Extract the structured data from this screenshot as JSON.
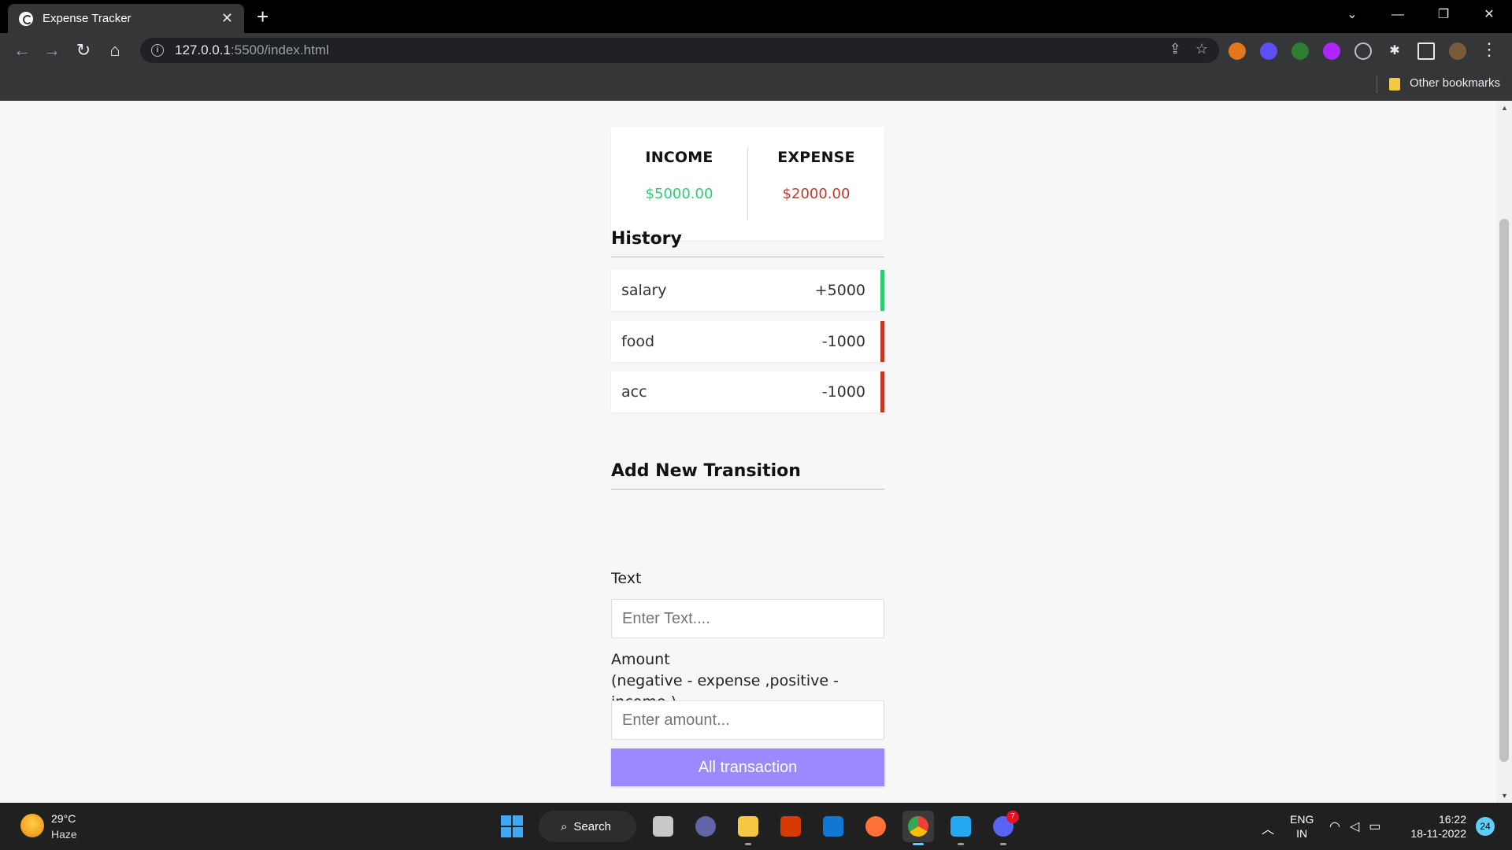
{
  "browser": {
    "tab_title": "Expense Tracker",
    "tab_close": "✕",
    "new_tab": "+",
    "url_host": "127.0.0.1",
    "url_path": ":5500/index.html",
    "bookmark_label": "Other bookmarks",
    "window_controls": {
      "chevron": "⌄",
      "minimize": "—",
      "restore": "❐",
      "close": "✕"
    },
    "extension_colors": [
      "#e2761b",
      "#5b4ff5",
      "#2e7d32",
      "#b025ff",
      "#bdc1c6"
    ]
  },
  "app": {
    "income_label": "INCOME",
    "expense_label": "EXPENSE",
    "income_value": "$5000.00",
    "expense_value": "$2000.00",
    "history_title": "History",
    "transactions": [
      {
        "text": "salary",
        "amount": "+5000",
        "type": "plus"
      },
      {
        "text": "food",
        "amount": "-1000",
        "type": "minus"
      },
      {
        "text": "acc",
        "amount": "-1000",
        "type": "minus"
      }
    ],
    "form_title": "Add New Transition",
    "text_label": "Text",
    "text_placeholder": "Enter Text....",
    "amount_label": "Amount",
    "amount_hint": "(negative - expense ,positive - income )",
    "amount_placeholder": "Enter amount...",
    "submit_label": "All transaction",
    "colors": {
      "income": "#2ecc71",
      "expense": "#c0392b",
      "button": "#9c88ff"
    }
  },
  "taskbar": {
    "temperature": "29°C",
    "condition": "Haze",
    "search_label": "Search",
    "discord_badge": "7",
    "lang_line1": "ENG",
    "lang_line2": "IN",
    "time": "16:22",
    "date": "18-11-2022",
    "notification_count": "24"
  }
}
